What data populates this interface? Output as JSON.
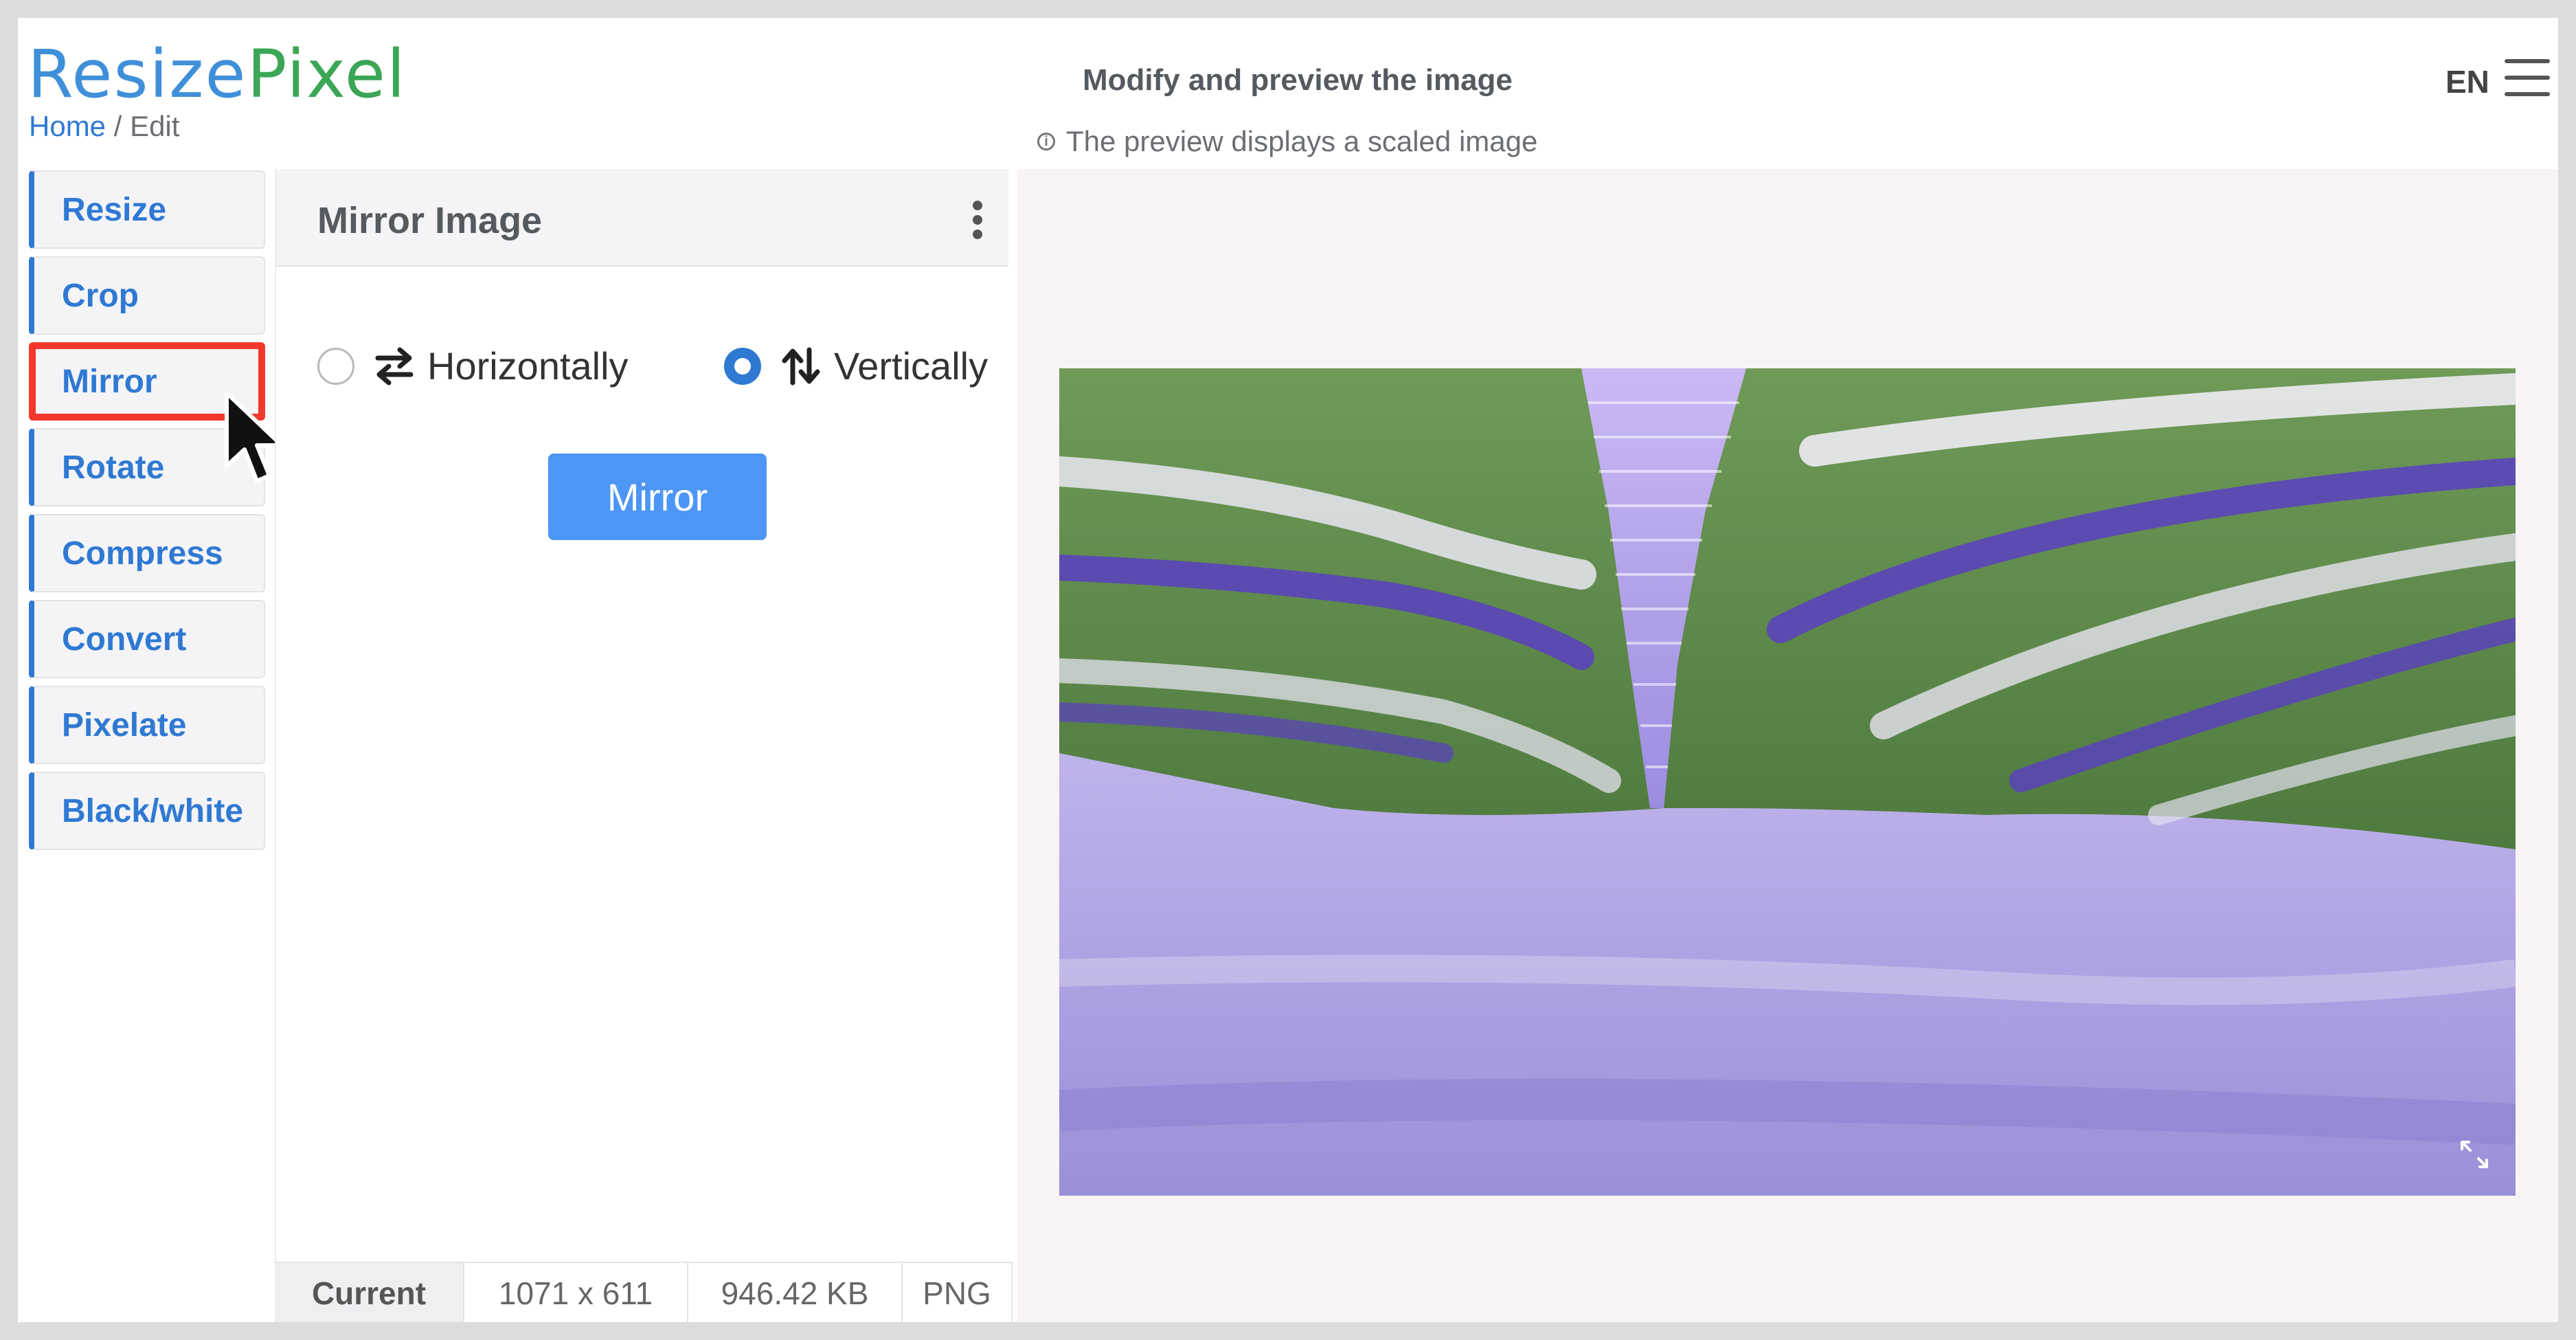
{
  "header": {
    "logo_part1": "Resize",
    "logo_part2": "Pixel",
    "breadcrumb_home": "Home",
    "breadcrumb_sep": " / ",
    "breadcrumb_current": "Edit",
    "title": "Modify and preview the image",
    "subtitle": "The preview displays a scaled image",
    "language": "EN"
  },
  "sidebar": {
    "items": [
      {
        "label": "Resize"
      },
      {
        "label": "Crop"
      },
      {
        "label": "Mirror",
        "active": true
      },
      {
        "label": "Rotate"
      },
      {
        "label": "Compress"
      },
      {
        "label": "Convert"
      },
      {
        "label": "Pixelate"
      },
      {
        "label": "Black/white"
      }
    ]
  },
  "panel": {
    "title": "Mirror Image",
    "options": [
      {
        "label": "Horizontally",
        "icon": "swap-horizontal-icon",
        "selected": false
      },
      {
        "label": "Vertically",
        "icon": "swap-vertical-icon",
        "selected": true
      }
    ],
    "button_label": "Mirror"
  },
  "status": {
    "current_label": "Current",
    "dimensions": "1071 x 611",
    "file_size": "946.42 KB",
    "format": "PNG"
  },
  "colors": {
    "accent": "#2f79d3",
    "button": "#4d96f5",
    "highlight": "#f2372b"
  }
}
